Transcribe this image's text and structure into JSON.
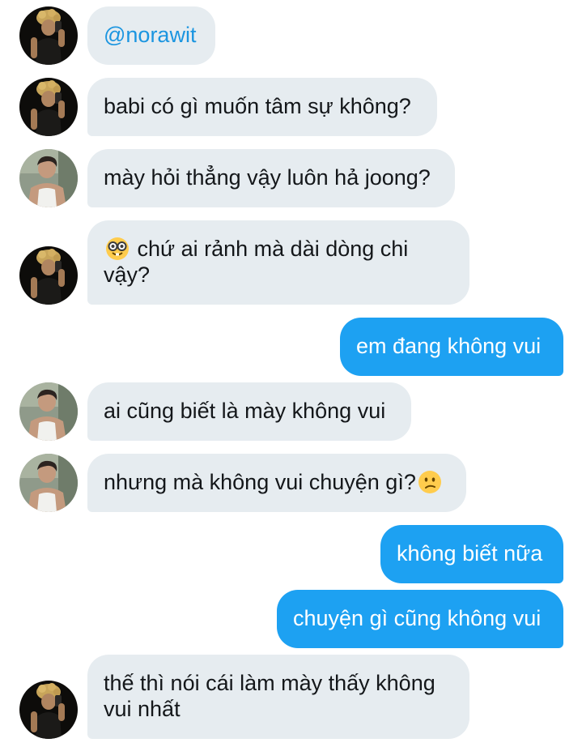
{
  "colors": {
    "incoming_bubble": "#e6ecf0",
    "outgoing_bubble": "#1da1f2",
    "mention": "#1b95e0",
    "text_dark": "#14171a"
  },
  "messages": [
    {
      "direction": "in",
      "sender": "joong",
      "avatar": "avatar-curly-hair-selfie",
      "text": "@norawit"
    },
    {
      "direction": "in",
      "sender": "joong",
      "avatar": "avatar-curly-hair-selfie",
      "text": "babi có gì muốn tâm sự không?"
    },
    {
      "direction": "in",
      "sender": "other",
      "avatar": "avatar-tank-top",
      "text": "mày hỏi thẳng vậy luôn hả joong?"
    },
    {
      "direction": "in",
      "sender": "joong",
      "avatar": "avatar-curly-hair-selfie",
      "emoji": "nerd-face-emoji",
      "line1": "chứ ai rảnh mà dài dòng chi",
      "line2": "vậy?"
    },
    {
      "direction": "out",
      "text": "em đang không vui"
    },
    {
      "direction": "in",
      "sender": "other",
      "avatar": "avatar-tank-top",
      "text": "ai cũng biết là mày không vui"
    },
    {
      "direction": "in",
      "sender": "other",
      "avatar": "avatar-tank-top",
      "text": "nhưng mà không vui chuyện gì?",
      "emoji": "confused-face-emoji"
    },
    {
      "direction": "out",
      "text": "không biết nữa"
    },
    {
      "direction": "out",
      "text": "chuyện gì cũng không vui"
    },
    {
      "direction": "in",
      "sender": "joong",
      "avatar": "avatar-curly-hair-selfie",
      "line1": "thế thì nói cái làm mày thấy không",
      "line2": "vui nhất"
    }
  ]
}
